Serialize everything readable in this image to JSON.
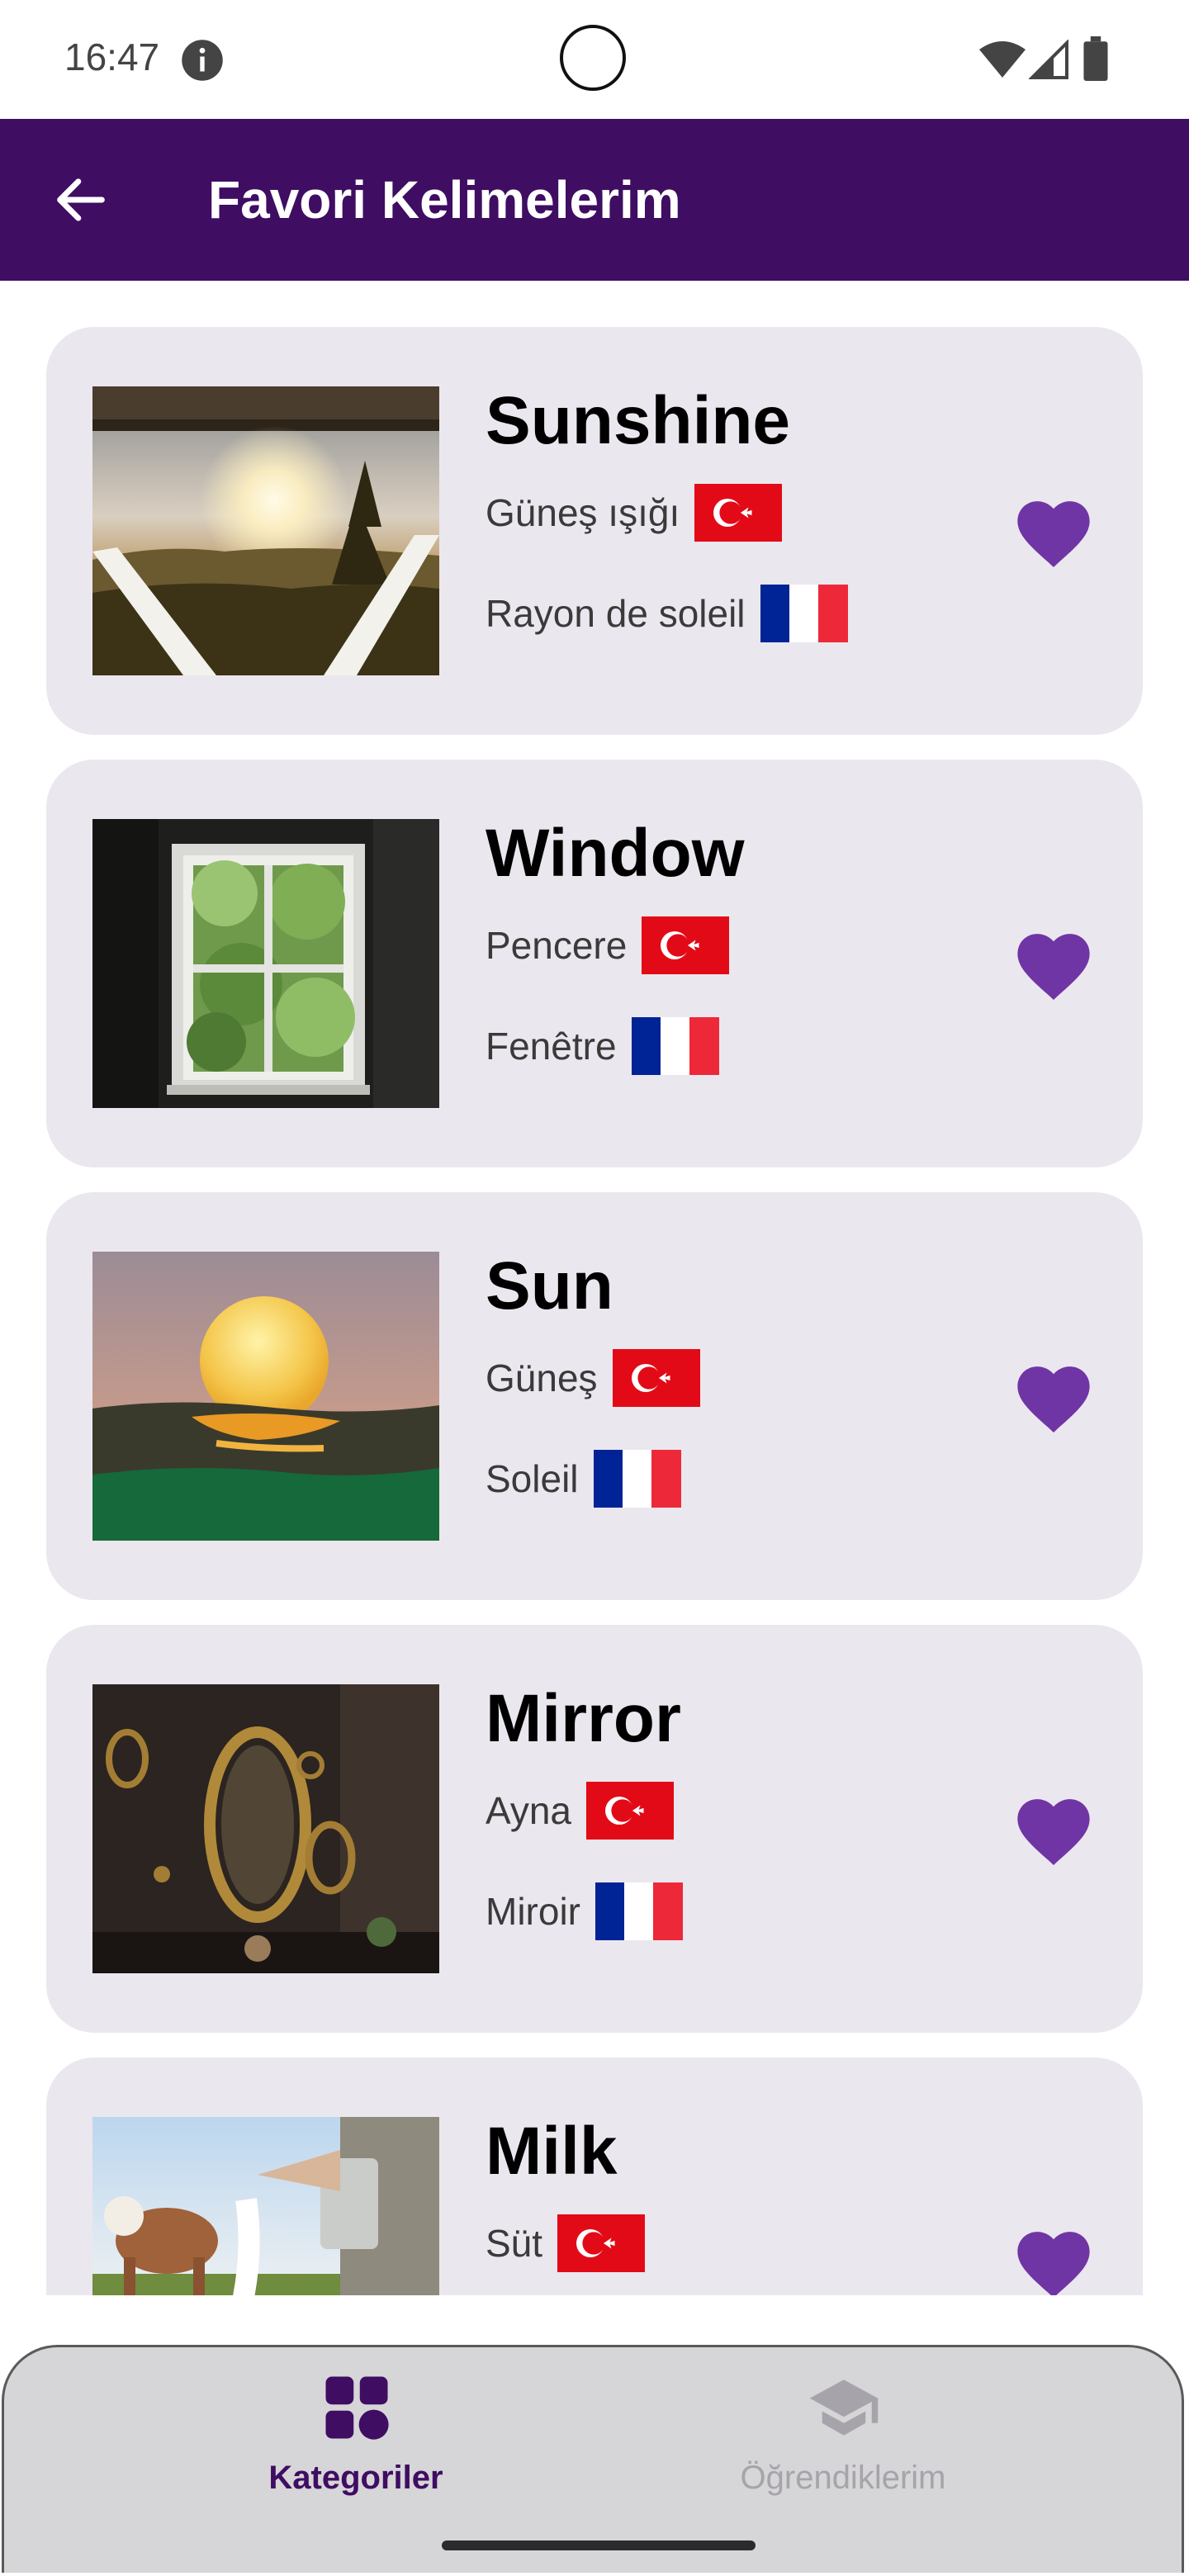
{
  "status_bar": {
    "time": "16:47"
  },
  "app_bar": {
    "title": "Favori Kelimelerim"
  },
  "colors": {
    "app_bar": "#3f0d62",
    "card": "#ebe7ee",
    "heart": "#6f35a5",
    "nav_active": "#3f0d62",
    "nav_inactive": "#a7a3ab"
  },
  "words": [
    {
      "word": "Sunshine",
      "turkish": "Güneş ışığı",
      "french": "Rayon de soleil",
      "image": "sunshine-photo",
      "favorite": true
    },
    {
      "word": "Window",
      "turkish": "Pencere",
      "french": "Fenêtre",
      "image": "window-photo",
      "favorite": true
    },
    {
      "word": "Sun",
      "turkish": "Güneş",
      "french": "Soleil",
      "image": "sun-photo",
      "favorite": true
    },
    {
      "word": "Mirror",
      "turkish": "Ayna",
      "french": "Miroir",
      "image": "mirror-photo",
      "favorite": true
    },
    {
      "word": "Milk",
      "turkish": "Süt",
      "french": "",
      "image": "milk-photo",
      "favorite": true
    }
  ],
  "bottom_nav": {
    "items": [
      {
        "label": "Kategoriler",
        "icon": "categories-icon",
        "active": true
      },
      {
        "label": "Öğrendiklerim",
        "icon": "graduation-cap-icon",
        "active": false
      }
    ]
  }
}
